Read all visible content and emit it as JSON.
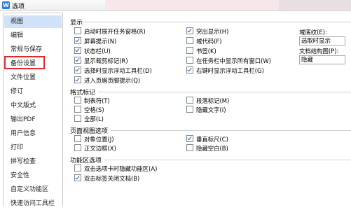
{
  "window": {
    "title": "选项",
    "app_icon": "W"
  },
  "sidebar": {
    "items": [
      {
        "label": "视图",
        "selected": true
      },
      {
        "label": "编辑"
      },
      {
        "label": "常规与保存"
      },
      {
        "label": "备份设置"
      },
      {
        "label": "文件位置"
      },
      {
        "label": "修订"
      },
      {
        "label": "中文版式"
      },
      {
        "label": "输出PDF"
      },
      {
        "label": "用户信息"
      },
      {
        "label": "打印"
      },
      {
        "label": "拼写检查"
      },
      {
        "label": "安全性"
      },
      {
        "label": "自定义功能区"
      },
      {
        "label": "快速访问工具栏"
      }
    ]
  },
  "sections": {
    "display": {
      "title": "显示",
      "col1": [
        {
          "label": "启动时展开任务窗格(R)",
          "checked": false
        },
        {
          "label": "屏幕提示(N)",
          "checked": true
        },
        {
          "label": "状态栏(U)",
          "checked": true
        },
        {
          "label": "显示裁剪标记(R)",
          "checked": true
        },
        {
          "label": "选择时显示浮动工具栏(D)",
          "checked": true
        },
        {
          "label": "进入页眉页脚提示(Q)",
          "checked": true
        }
      ],
      "col2": [
        {
          "label": "突出显示(H)",
          "checked": true
        },
        {
          "label": "域代码(F)",
          "checked": false
        },
        {
          "label": "书签(K)",
          "checked": false
        },
        {
          "label": "在任务栏中显示所有窗口(W)",
          "checked": false
        },
        {
          "label": "右键时显示浮动工具栏(G)",
          "checked": true
        }
      ],
      "field_shading_label": "域底纹(E):",
      "field_shading_value": "选取时显示",
      "doc_map_label": "文档结构图(P):",
      "doc_map_value": "隐藏"
    },
    "format_marks": {
      "title": "格式标记",
      "col1": [
        {
          "label": "制表符(T)",
          "checked": false
        },
        {
          "label": "空格(S)",
          "checked": false
        },
        {
          "label": "全部(L)",
          "checked": false
        }
      ],
      "col2": [
        {
          "label": "段落标记(M)",
          "checked": false
        },
        {
          "label": "隐藏文字(I)",
          "checked": false
        }
      ]
    },
    "page_view": {
      "title": "页面视图选项",
      "col1": [
        {
          "label": "对象位置(J)",
          "checked": false
        },
        {
          "label": "正文边框(X)",
          "checked": false
        }
      ],
      "col2": [
        {
          "label": "垂直标尺(C)",
          "checked": true
        },
        {
          "label": "隐藏空白(B)",
          "checked": false
        }
      ]
    },
    "ribbon": {
      "title": "功能区选项",
      "col1": [
        {
          "label": "双击选项卡时隐藏功能区(A)",
          "checked": false
        },
        {
          "label": "双击标签关闭文档(B)",
          "checked": true
        }
      ]
    }
  },
  "colors": {
    "selected_bg": "#cfe2f7",
    "highlight": "#e0282e",
    "check": "#2b5c9b"
  }
}
